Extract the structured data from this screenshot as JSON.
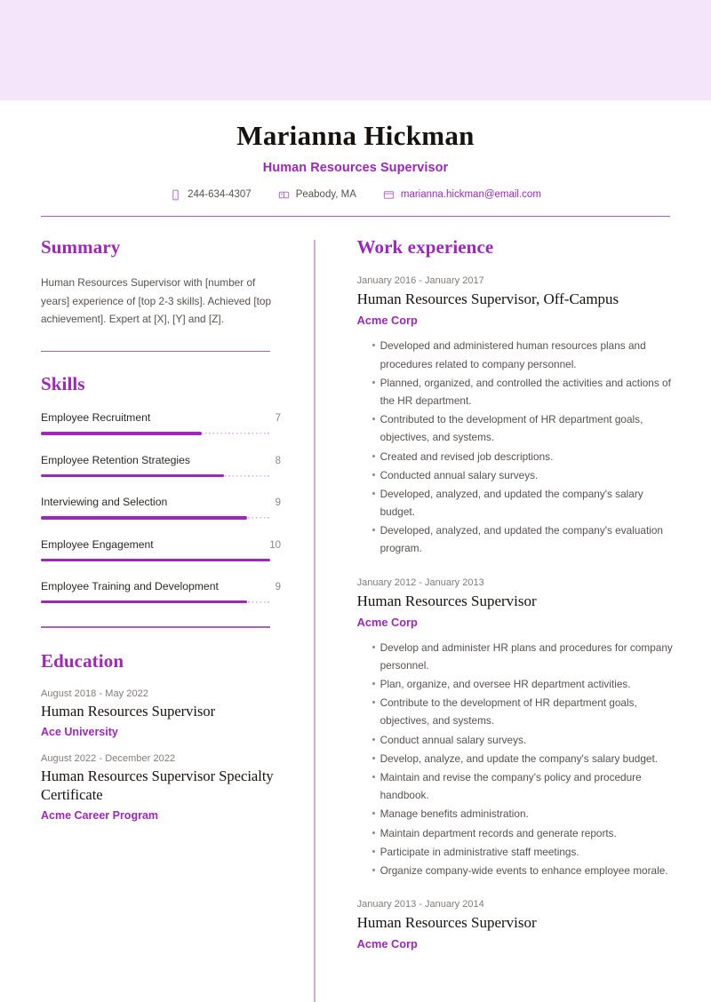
{
  "theme": {
    "banner_color": "#f5e5fa",
    "accent_color": "#9c27b9",
    "rule_color": "#a45ec4",
    "body_text_color": "#55524f",
    "heading_text_color": "#15120f"
  },
  "header": {
    "full_name": "Marianna Hickman",
    "job_title": "Human Resources Supervisor",
    "contacts": [
      {
        "icon": "phone-icon",
        "value": "244-634-4307",
        "is_link": false
      },
      {
        "icon": "location-icon",
        "value": "Peabody, MA",
        "is_link": false
      },
      {
        "icon": "email-icon",
        "value": "marianna.hickman@email.com",
        "is_link": true
      }
    ]
  },
  "sidebar": {
    "summary": {
      "title": "Summary",
      "text": "Human Resources Supervisor with [number of years] experience of [top 2-3 skills]. Achieved [top achievement]. Expert at [X], [Y] and [Z]."
    },
    "skills": {
      "title": "Skills",
      "max_score": 10,
      "items": [
        {
          "name": "Employee Recruitment",
          "score": "7",
          "percent": 70
        },
        {
          "name": "Employee Retention Strategies",
          "score": "8",
          "percent": 80
        },
        {
          "name": "Interviewing and Selection",
          "score": "9",
          "percent": 90
        },
        {
          "name": "Employee Engagement",
          "score": "10",
          "percent": 100
        },
        {
          "name": "Employee Training and Development",
          "score": "9",
          "percent": 90
        }
      ]
    },
    "education": {
      "title": "Education",
      "items": [
        {
          "date": "August 2018 - May 2022",
          "degree": "Human Resources Supervisor",
          "school": "Ace University"
        },
        {
          "date": "August 2022 - December 2022",
          "degree": "Human Resources Supervisor Specialty Certificate",
          "school": "Acme Career Program"
        }
      ]
    }
  },
  "main": {
    "work_experience": {
      "title": "Work experience",
      "jobs": [
        {
          "date": "January 2016 - January 2017",
          "role": "Human Resources Supervisor, Off-Campus",
          "company": "Acme Corp",
          "bullets": [
            "Developed and administered human resources plans and procedures related to company personnel.",
            "Planned, organized, and controlled the activities and actions of the HR department.",
            "Contributed to the development of HR department goals, objectives, and systems.",
            "Created and revised job descriptions.",
            "Conducted annual salary surveys.",
            "Developed, analyzed, and updated the company's salary budget.",
            "Developed, analyzed, and updated the company's evaluation program."
          ]
        },
        {
          "date": "January 2012 - January 2013",
          "role": "Human Resources Supervisor",
          "company": "Acme Corp",
          "bullets": [
            "Develop and administer HR plans and procedures for company personnel.",
            "Plan, organize, and oversee HR department activities.",
            "Contribute to the development of HR department goals, objectives, and systems.",
            "Conduct annual salary surveys.",
            "Develop, analyze, and update the company's salary budget.",
            "Maintain and revise the company's policy and procedure handbook.",
            "Manage benefits administration.",
            "Maintain department records and generate reports.",
            "Participate in administrative staff meetings.",
            "Organize company-wide events to enhance employee morale."
          ]
        },
        {
          "date": "January 2013 - January 2014",
          "role": "Human Resources Supervisor",
          "company": "Acme Corp",
          "bullets": []
        }
      ]
    }
  }
}
